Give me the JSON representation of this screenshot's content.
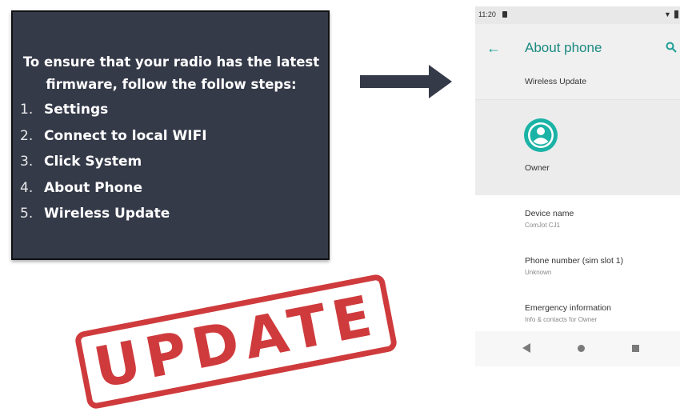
{
  "instructions": {
    "heading_line1": "To ensure that your radio has the latest",
    "heading_line2": "firmware, follow the follow steps:",
    "steps": [
      {
        "num": "1.",
        "text": "Settings"
      },
      {
        "num": "2.",
        "text": "Connect to local WIFI"
      },
      {
        "num": "3.",
        "text": "Click System"
      },
      {
        "num": "4.",
        "text": "About Phone"
      },
      {
        "num": "5.",
        "text": "Wireless Update"
      }
    ]
  },
  "stamp": {
    "text": "UPDATE"
  },
  "phone": {
    "status_bar": {
      "time": "11:20"
    },
    "app_bar": {
      "title": "About phone"
    },
    "wireless_update_label": "Wireless Update",
    "owner_label": "Owner",
    "items": [
      {
        "title": "Device name",
        "subtitle": "ComJot CJ1"
      },
      {
        "title": "Phone number (sim slot 1)",
        "subtitle": "Unknown"
      },
      {
        "title": "Emergency information",
        "subtitle": "Info & contacts for Owner"
      }
    ]
  },
  "colors": {
    "panel_bg": "#353a49",
    "accent_teal": "#1a9e93",
    "stamp_red": "#cf3b3d",
    "arrow": "#353a49"
  },
  "icons": [
    "arrow-right-icon",
    "back-arrow-icon",
    "search-icon",
    "avatar-icon",
    "nav-back-icon",
    "nav-home-icon",
    "nav-recents-icon",
    "wifi-icon",
    "battery-icon",
    "sim-icon"
  ]
}
